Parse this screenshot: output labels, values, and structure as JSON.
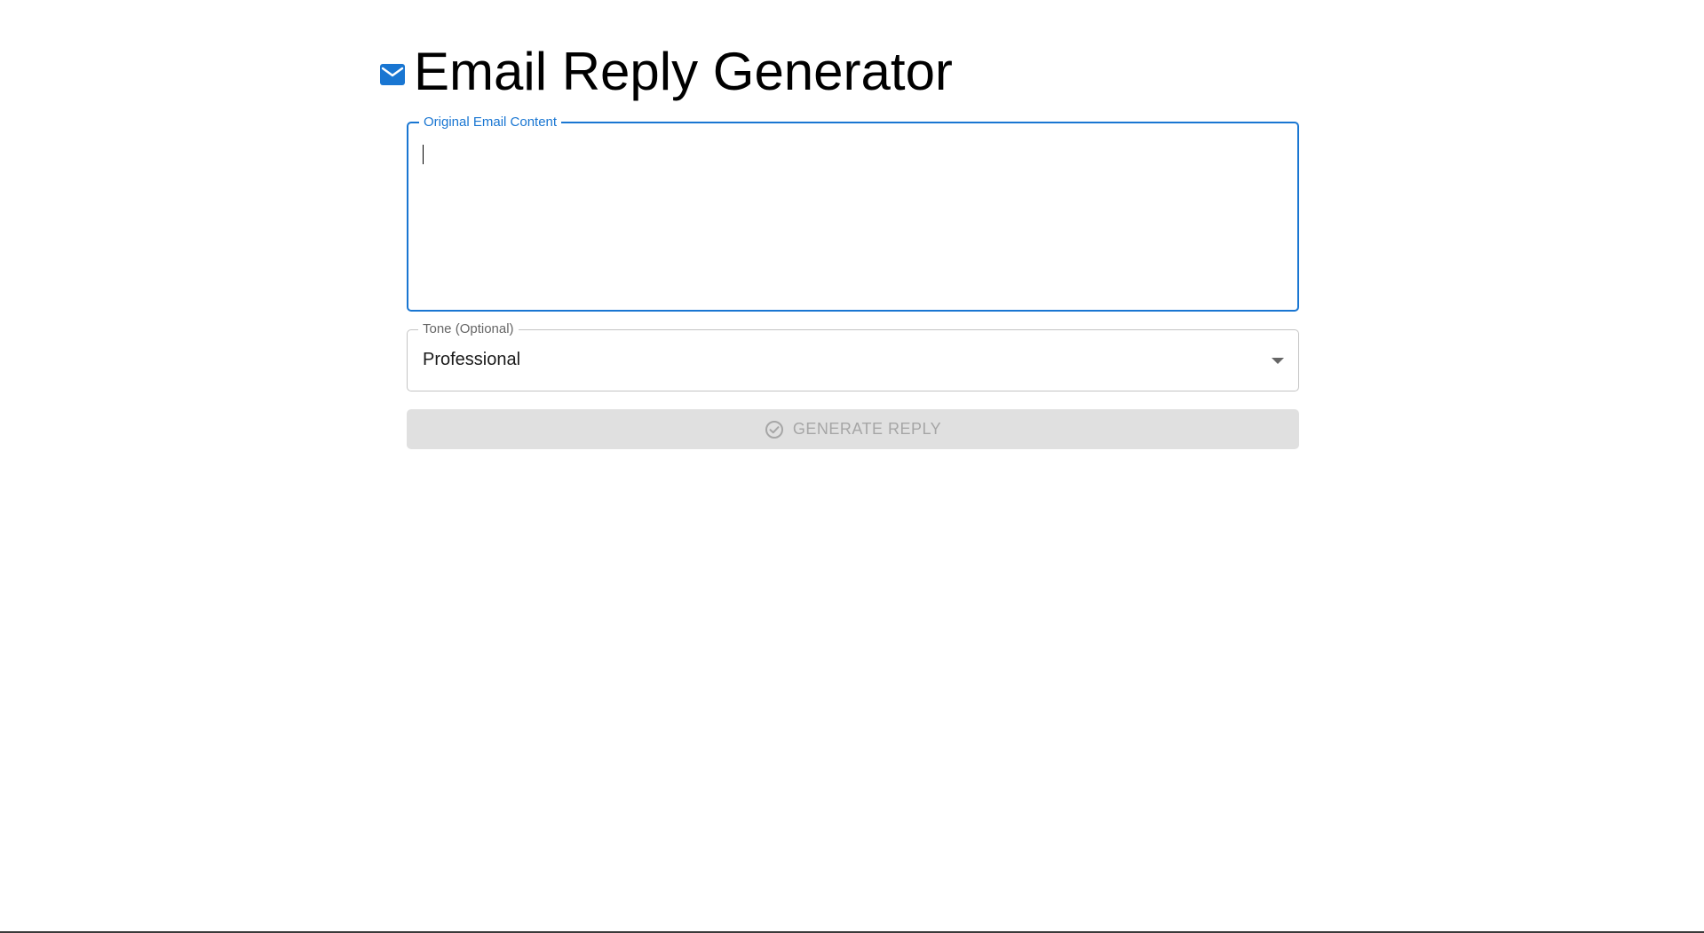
{
  "header": {
    "title": "Email Reply Generator",
    "icon": "mail-icon",
    "icon_color": "#1976d2"
  },
  "email_field": {
    "label": "Original Email Content",
    "value": ""
  },
  "tone_field": {
    "label": "Tone (Optional)",
    "selected": "Professional",
    "icon": "chevron-down-icon"
  },
  "generate_button": {
    "label": "GENERATE REPLY",
    "icon": "check-circle-icon",
    "disabled": true
  },
  "colors": {
    "accent": "#1976d2",
    "disabled_bg": "#e0e0e0",
    "disabled_text": "#a6a6a6"
  }
}
